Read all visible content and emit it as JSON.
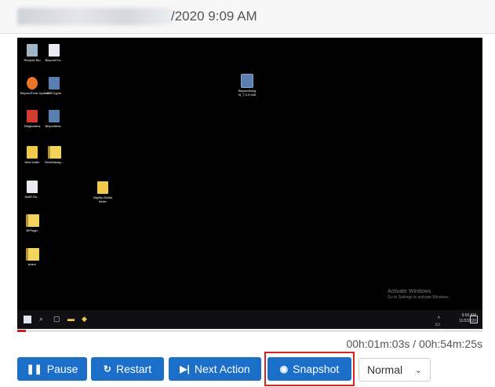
{
  "header": {
    "title_visible": "/2020 9:09 AM"
  },
  "desktop": {
    "icons": [
      {
        "label": "Recycle Bin",
        "name": "recycle-bin-icon"
      },
      {
        "label": "BeyondTru...",
        "name": "document-icon"
      },
      {
        "label": "BeyondTrust Updater",
        "name": "updater-icon"
      },
      {
        "label": "ISSCrypto",
        "name": "app-icon"
      },
      {
        "label": "Diagnostics",
        "name": "diagnostics-icon"
      },
      {
        "label": "BeyondInsi...",
        "name": "app-icon"
      },
      {
        "label": "New folder",
        "name": "folder-icon"
      },
      {
        "label": "RemManag...",
        "name": "zip-folder-icon"
      },
      {
        "label": "AntiE.Ru...",
        "name": "document-icon"
      },
      {
        "label": "BIPlugin",
        "name": "zip-folder-icon"
      },
      {
        "label": "pbsm",
        "name": "zip-folder-icon"
      },
      {
        "label": "Nightly Builds folder",
        "name": "folder-shortcut-icon"
      },
      {
        "label": "BeyondInsig ht_7.2.0.946",
        "name": "installer-icon"
      }
    ],
    "taskbar": {
      "time": "9:00 AM",
      "date": "11/2/2020"
    },
    "watermark": {
      "line1": "Activate Windows",
      "line2": "Go to Settings to activate Windows."
    }
  },
  "playback": {
    "progress_fraction": 0.019,
    "time_display": "00h:01m:03s / 00h:54m:25s"
  },
  "controls": {
    "pause_label": "Pause",
    "restart_label": "Restart",
    "next_action_label": "Next Action",
    "snapshot_label": "Snapshot",
    "speed_selected": "Normal"
  },
  "colors": {
    "button": "#1b6fc9",
    "progress": "#cc1f1f",
    "highlight": "#d62323"
  }
}
